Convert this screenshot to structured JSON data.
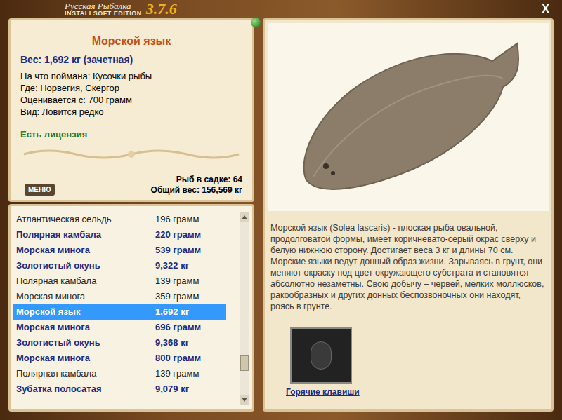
{
  "window": {
    "title_line1": "Русская Рыбалка",
    "title_line2": "INSTALLSOFT EDITION",
    "version": "3.7.6",
    "close": "X"
  },
  "fish": {
    "name": "Морской язык",
    "weight": "Вес: 1,692 кг (зачетная)",
    "details": [
      "На что поймана: Кусочки рыбы",
      "Где: Норвегия, Скергор",
      "Оценивается с: 700 грамм",
      "Вид: Ловится редко"
    ],
    "license": "Есть лицензия",
    "description": "Морской язык (Solea lascaris) - плоская рыба овальной, продолговатой формы, имеет коричневато-серый окрас сверху и белую нижнюю сторону. Достигает веса 3 кг и длины 70 см. Морские языки ведут донный образ жизни. Зарываясь в грунт, они меняют окраску под цвет окружающего субстрата и становятся абсолютно незаметны. Свою добычу – червей, мелких моллюсков, ракообразных и других донных беспозвоночных они находят, роясь в грунте."
  },
  "keepnet": {
    "count": "Рыб в садке: 64",
    "total": "Общий вес: 156,569 кг"
  },
  "menu_button": "МЕНЮ",
  "catches": [
    {
      "name": "Атлантическая сельдь",
      "weight": "196 грамм",
      "trophy": false,
      "selected": false
    },
    {
      "name": "Полярная камбала",
      "weight": "220 грамм",
      "trophy": true,
      "selected": false
    },
    {
      "name": "Морская минога",
      "weight": "539 грамм",
      "trophy": true,
      "selected": false
    },
    {
      "name": "Золотистый окунь",
      "weight": "9,322 кг",
      "trophy": true,
      "selected": false
    },
    {
      "name": "Полярная камбала",
      "weight": "139 грамм",
      "trophy": false,
      "selected": false
    },
    {
      "name": "Морская минога",
      "weight": "359 грамм",
      "trophy": false,
      "selected": false
    },
    {
      "name": "Морской язык",
      "weight": "1,692 кг",
      "trophy": true,
      "selected": true
    },
    {
      "name": "Морская минога",
      "weight": "696 грамм",
      "trophy": true,
      "selected": false
    },
    {
      "name": "Золотистый окунь",
      "weight": "9,368 кг",
      "trophy": true,
      "selected": false
    },
    {
      "name": "Морская минога",
      "weight": "800 грамм",
      "trophy": true,
      "selected": false
    },
    {
      "name": "Полярная камбала",
      "weight": "139 грамм",
      "trophy": false,
      "selected": false
    },
    {
      "name": "Зубатка полосатая",
      "weight": "9,079 кг",
      "trophy": true,
      "selected": false
    }
  ],
  "scrollbar": {
    "level": 0.85
  },
  "hotkeys": {
    "label": "Горячие клавиши"
  }
}
